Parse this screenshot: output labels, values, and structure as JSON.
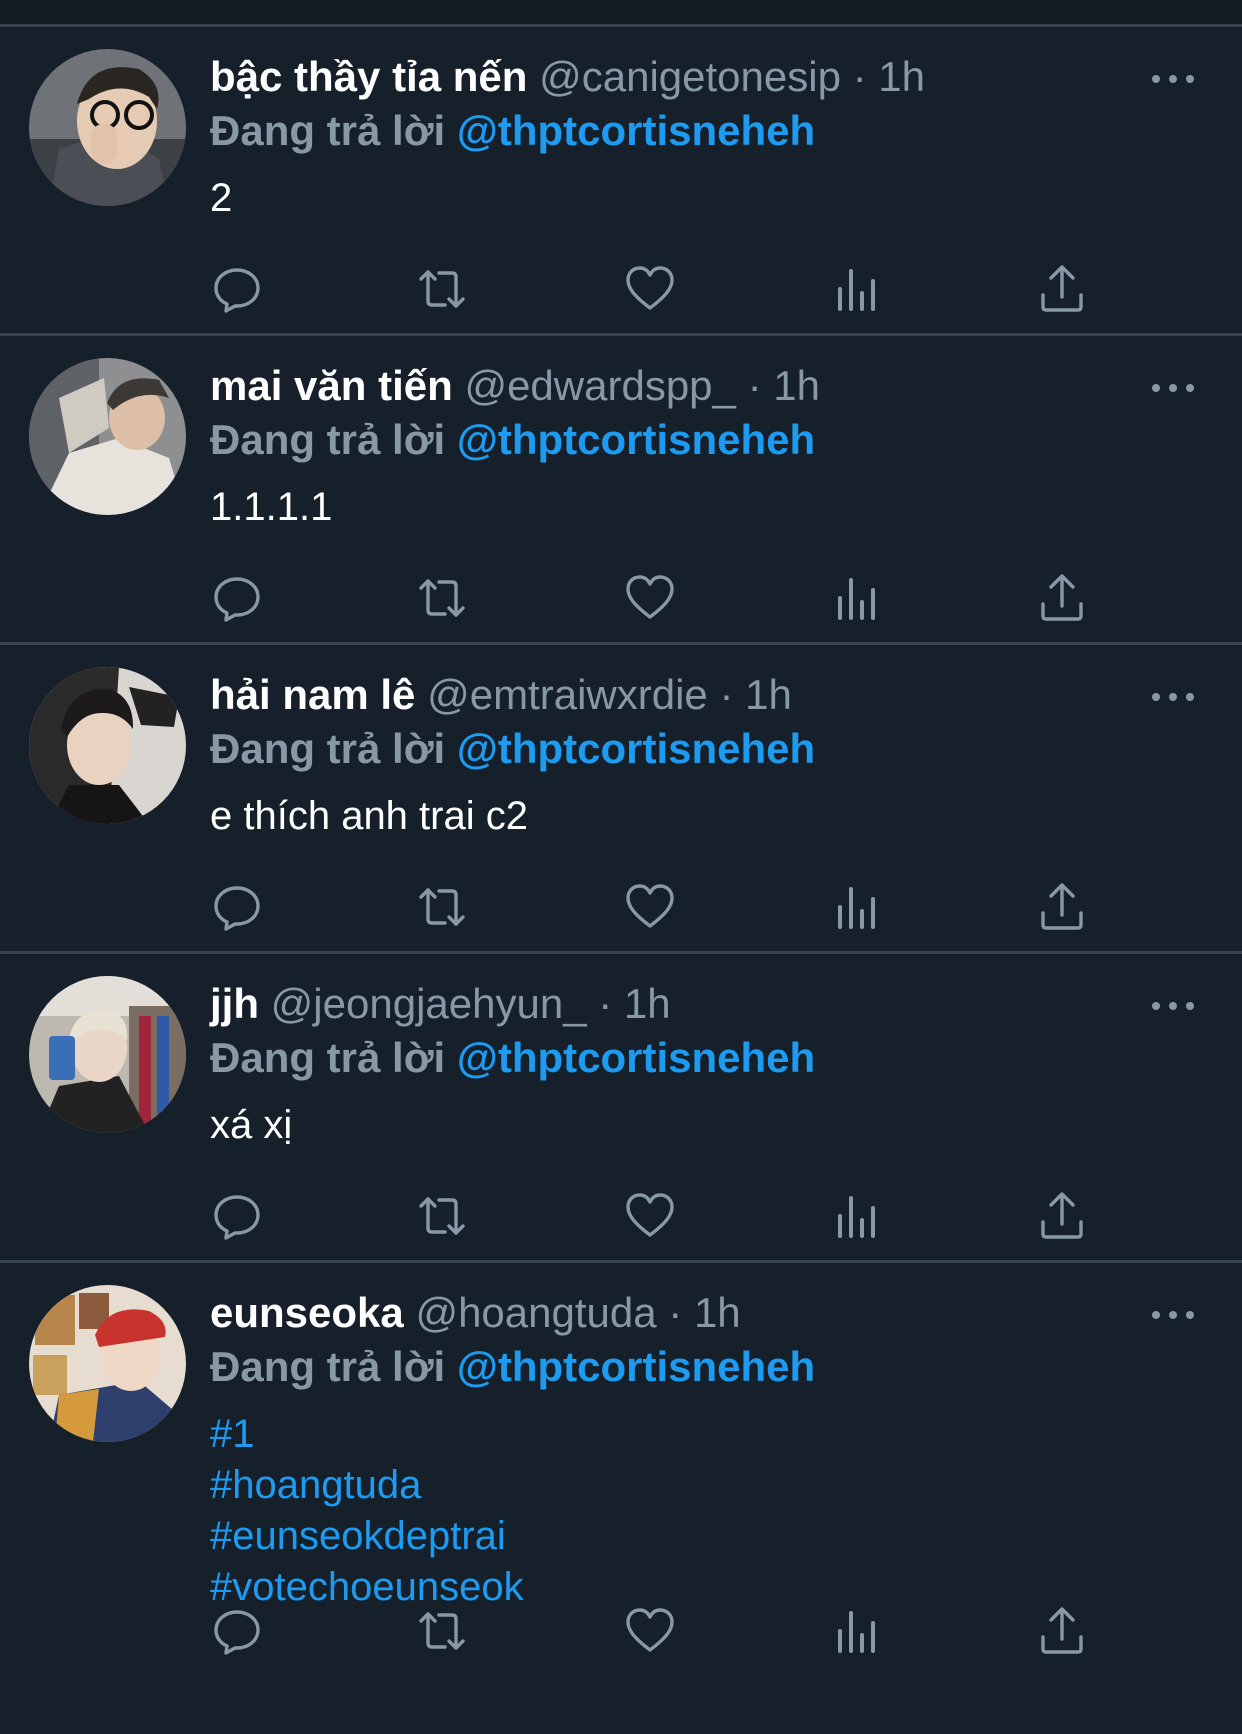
{
  "theme": {
    "background": "#15202b",
    "divider": "#38444d",
    "secondary_text": "#8899a6",
    "accent": "#1d9bf0"
  },
  "tweets": [
    {
      "display_name": "bậc thầy tỉa nến",
      "handle": "@canigetonesip",
      "separator": "·",
      "time": "1h",
      "reply_prefix": "Đang trả lời",
      "reply_target": "@thptcortisneheh",
      "text": "2",
      "avatar": "avatar-photo"
    },
    {
      "display_name": "mai văn tiến",
      "handle": "@edwardspp_",
      "separator": "·",
      "time": "1h",
      "reply_prefix": "Đang trả lời",
      "reply_target": "@thptcortisneheh",
      "text": "1.1.1.1",
      "avatar": "avatar-photo"
    },
    {
      "display_name": "hải nam lê",
      "handle": "@emtraiwxrdie",
      "separator": "·",
      "time": "1h",
      "reply_prefix": "Đang trả lời",
      "reply_target": "@thptcortisneheh",
      "text": "e thích anh trai c2",
      "avatar": "avatar-photo"
    },
    {
      "display_name": "jjh",
      "handle": "@jeongjaehyun_",
      "separator": "·",
      "time": "1h",
      "reply_prefix": "Đang trả lời",
      "reply_target": "@thptcortisneheh",
      "text": "xá xị",
      "avatar": "avatar-photo"
    },
    {
      "display_name": "eunseoka",
      "handle": "@hoangtuda",
      "separator": "·",
      "time": "1h",
      "reply_prefix": "Đang trả lời",
      "reply_target": "@thptcortisneheh",
      "hashtags": [
        "#1",
        "#hoangtuda",
        "#eunseokdeptrai",
        "#votechoeunseok"
      ],
      "avatar": "avatar-photo"
    }
  ],
  "icons": {
    "more": "more-horizontal-icon",
    "reply": "reply-icon",
    "retweet": "retweet-icon",
    "like": "heart-icon",
    "views": "analytics-icon",
    "share": "share-icon"
  }
}
